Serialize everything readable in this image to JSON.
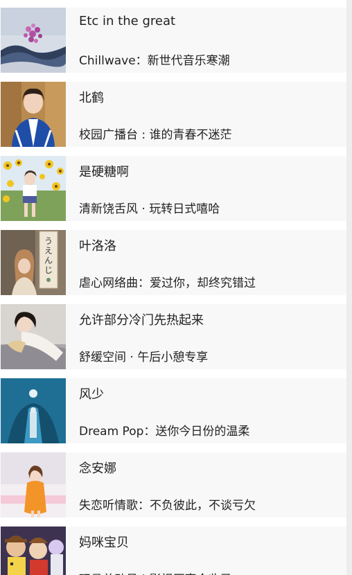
{
  "playlists": [
    {
      "title": "Etc in the great",
      "subtitle": "Chillwave：新世代音乐寒潮"
    },
    {
      "title": "北鹤",
      "subtitle": "校园广播台 : 谁的青春不迷茫"
    },
    {
      "title": "是硬糖啊",
      "subtitle": "清新饶舌风 · 玩转日式嘻哈"
    },
    {
      "title": "叶洛洛",
      "subtitle": "虐心网络曲：爱过你，却终究错过"
    },
    {
      "title": "允许部分冷门先热起来",
      "subtitle": "舒缓空间 · 午后小憩专享"
    },
    {
      "title": "风少",
      "subtitle": "Dream Pop：送你今日份的温柔"
    },
    {
      "title": "念安娜",
      "subtitle": "失恋听情歌：不负彼此，不谈亏欠"
    },
    {
      "title": "妈咪宝贝",
      "subtitle": "玩具总动员 | 影视原声合收录"
    }
  ],
  "thumbnail_signs": {
    "sign_kana": "うえんじ"
  }
}
